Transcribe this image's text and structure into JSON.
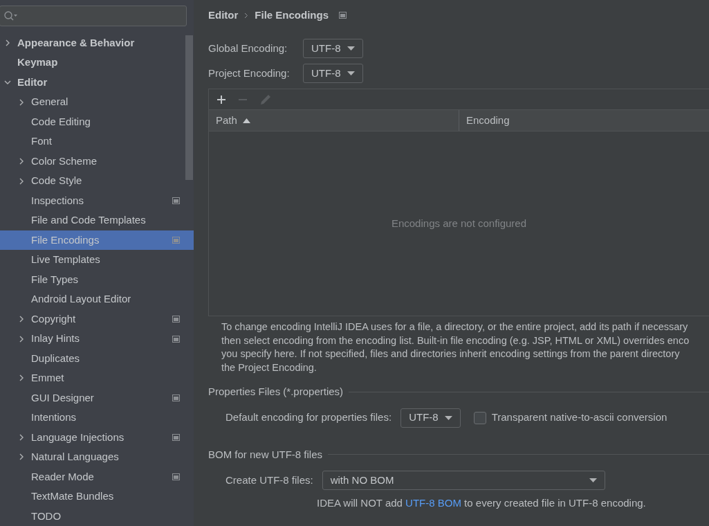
{
  "sidebar": {
    "items": [
      {
        "label": "Appearance & Behavior",
        "expandable": true,
        "expanded": false,
        "selected": false,
        "project_level": false
      },
      {
        "label": "Keymap",
        "expandable": false,
        "selected": false,
        "project_level": false
      },
      {
        "label": "Editor",
        "expandable": true,
        "expanded": true,
        "selected": false,
        "project_level": false,
        "children": [
          {
            "label": "General",
            "expandable": true,
            "expanded": false,
            "selected": false,
            "project_level": false
          },
          {
            "label": "Code Editing",
            "expandable": false,
            "selected": false,
            "project_level": false
          },
          {
            "label": "Font",
            "expandable": false,
            "selected": false,
            "project_level": false
          },
          {
            "label": "Color Scheme",
            "expandable": true,
            "expanded": false,
            "selected": false,
            "project_level": false
          },
          {
            "label": "Code Style",
            "expandable": true,
            "expanded": false,
            "selected": false,
            "project_level": false
          },
          {
            "label": "Inspections",
            "expandable": false,
            "selected": false,
            "project_level": true
          },
          {
            "label": "File and Code Templates",
            "expandable": false,
            "selected": false,
            "project_level": false
          },
          {
            "label": "File Encodings",
            "expandable": false,
            "selected": true,
            "project_level": true
          },
          {
            "label": "Live Templates",
            "expandable": false,
            "selected": false,
            "project_level": false
          },
          {
            "label": "File Types",
            "expandable": false,
            "selected": false,
            "project_level": false
          },
          {
            "label": "Android Layout Editor",
            "expandable": false,
            "selected": false,
            "project_level": false
          },
          {
            "label": "Copyright",
            "expandable": true,
            "expanded": false,
            "selected": false,
            "project_level": true
          },
          {
            "label": "Inlay Hints",
            "expandable": true,
            "expanded": false,
            "selected": false,
            "project_level": true
          },
          {
            "label": "Duplicates",
            "expandable": false,
            "selected": false,
            "project_level": false
          },
          {
            "label": "Emmet",
            "expandable": true,
            "expanded": false,
            "selected": false,
            "project_level": false
          },
          {
            "label": "GUI Designer",
            "expandable": false,
            "selected": false,
            "project_level": true
          },
          {
            "label": "Intentions",
            "expandable": false,
            "selected": false,
            "project_level": false
          },
          {
            "label": "Language Injections",
            "expandable": true,
            "expanded": false,
            "selected": false,
            "project_level": true
          },
          {
            "label": "Natural Languages",
            "expandable": true,
            "expanded": false,
            "selected": false,
            "project_level": false
          },
          {
            "label": "Reader Mode",
            "expandable": false,
            "selected": false,
            "project_level": true
          },
          {
            "label": "TextMate Bundles",
            "expandable": false,
            "selected": false,
            "project_level": false
          },
          {
            "label": "TODO",
            "expandable": false,
            "selected": false,
            "project_level": false
          }
        ]
      }
    ]
  },
  "breadcrumb": [
    "Editor",
    "File Encodings"
  ],
  "global_encoding": {
    "label": "Global Encoding:",
    "value": "UTF-8"
  },
  "project_encoding": {
    "label": "Project Encoding:",
    "value": "UTF-8"
  },
  "table": {
    "toolbar": [
      {
        "kind": "add",
        "disabled": false
      },
      {
        "kind": "remove",
        "disabled": true
      },
      {
        "kind": "edit",
        "disabled": true
      }
    ],
    "columns": [
      {
        "label": "Path",
        "sorted": true
      },
      {
        "label": "Encoding",
        "sorted": false
      }
    ],
    "empty_text": "Encodings are not configured"
  },
  "description": [
    "To change encoding IntelliJ IDEA uses for a file, a directory, or the entire project, add its path if necessary",
    "then select encoding from the encoding list. Built-in file encoding (e.g. JSP, HTML or XML) overrides enco",
    "you specify here. If not specified, files and directories inherit encoding settings from the parent directory",
    "the Project Encoding."
  ],
  "properties_section": {
    "title": "Properties Files (*.properties)",
    "label": "Default encoding for properties files:",
    "value": "UTF-8",
    "checkbox": {
      "label": "Transparent native-to-ascii conversion",
      "checked": false
    }
  },
  "bom_section": {
    "title": "BOM for new UTF-8 files",
    "label": "Create UTF-8 files:",
    "value": "with NO BOM",
    "note": {
      "before": "IDEA will NOT add ",
      "link": "UTF-8 BOM",
      "after": " to every created file in UTF-8 encoding."
    }
  }
}
